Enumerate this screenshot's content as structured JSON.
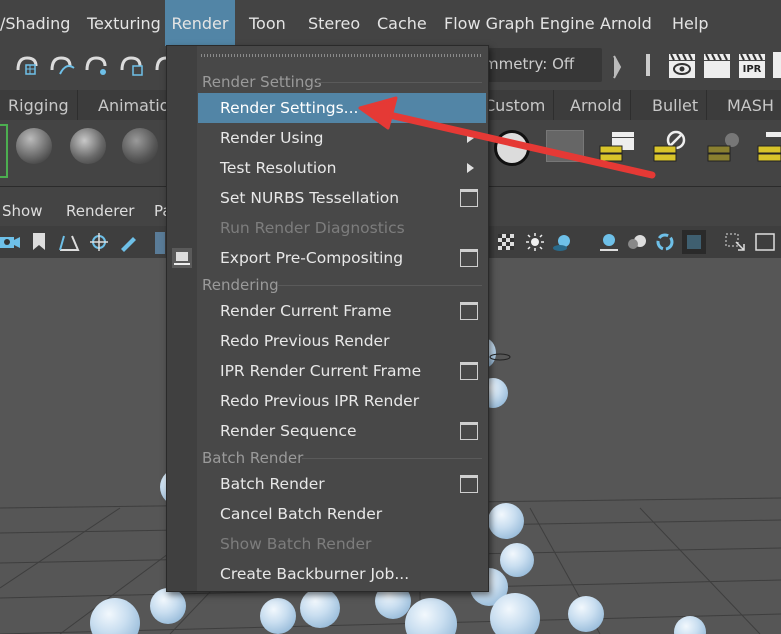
{
  "menubar": {
    "items": [
      {
        "label": "/Shading"
      },
      {
        "label": "Texturing"
      },
      {
        "label": "Render"
      },
      {
        "label": "Toon"
      },
      {
        "label": "Stereo"
      },
      {
        "label": "Cache"
      },
      {
        "label": "Flow Graph Engine"
      },
      {
        "label": "Arnold"
      },
      {
        "label": "Help"
      }
    ],
    "active_index": 2
  },
  "toolbar": {
    "symmetry_label": "mmetry: Off",
    "ipr_label": "IPR"
  },
  "shelf_tabs": [
    "Rigging",
    "Animation",
    "Custom",
    "Arnold",
    "Bullet",
    "MASH"
  ],
  "panel_menu": [
    "Show",
    "Renderer",
    "Pa"
  ],
  "dropdown": {
    "sections": [
      {
        "title": "Render Settings"
      },
      {
        "title": "Rendering"
      },
      {
        "title": "Batch Render"
      }
    ],
    "items": [
      {
        "label": "Render Settings...",
        "highlighted": true,
        "disabled": false,
        "option_box": false,
        "submenu": false
      },
      {
        "label": "Render Using",
        "highlighted": false,
        "disabled": false,
        "option_box": false,
        "submenu": true
      },
      {
        "label": "Test Resolution",
        "highlighted": false,
        "disabled": false,
        "option_box": false,
        "submenu": true
      },
      {
        "label": "Set NURBS Tessellation",
        "highlighted": false,
        "disabled": false,
        "option_box": true,
        "submenu": false
      },
      {
        "label": "Run Render Diagnostics",
        "highlighted": false,
        "disabled": true,
        "option_box": false,
        "submenu": false
      },
      {
        "label": "Export Pre-Compositing",
        "highlighted": false,
        "disabled": false,
        "option_box": true,
        "submenu": false
      },
      {
        "label": "Render Current Frame",
        "highlighted": false,
        "disabled": false,
        "option_box": true,
        "submenu": false
      },
      {
        "label": "Redo Previous Render",
        "highlighted": false,
        "disabled": false,
        "option_box": false,
        "submenu": false
      },
      {
        "label": "IPR Render Current Frame",
        "highlighted": false,
        "disabled": false,
        "option_box": true,
        "submenu": false
      },
      {
        "label": "Redo Previous IPR Render",
        "highlighted": false,
        "disabled": false,
        "option_box": false,
        "submenu": false
      },
      {
        "label": "Render Sequence",
        "highlighted": false,
        "disabled": false,
        "option_box": true,
        "submenu": false
      },
      {
        "label": "Batch Render",
        "highlighted": false,
        "disabled": false,
        "option_box": true,
        "submenu": false
      },
      {
        "label": "Cancel Batch Render",
        "highlighted": false,
        "disabled": false,
        "option_box": false,
        "submenu": false
      },
      {
        "label": "Show Batch Render",
        "highlighted": false,
        "disabled": true,
        "option_box": false,
        "submenu": false
      },
      {
        "label": "Create Backburner Job...",
        "highlighted": false,
        "disabled": false,
        "option_box": false,
        "submenu": false
      }
    ]
  },
  "colors": {
    "highlight": "#5285a6",
    "annotation_arrow": "#e53935",
    "background": "#444444"
  }
}
